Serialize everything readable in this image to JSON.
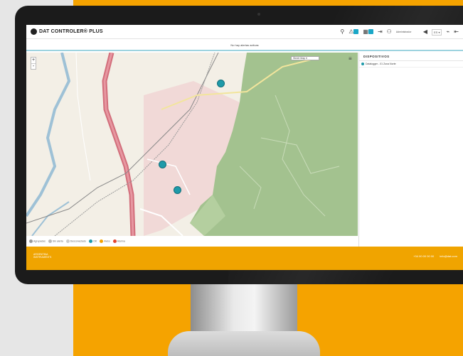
{
  "header": {
    "brand": "DAT CONTROLER® PLUS",
    "icons": [
      "pin-icon",
      "warning-icon",
      "notification-icon",
      "export-icon",
      "user-icon",
      "volume-icon",
      "language-select",
      "signal-icon",
      "logout-icon"
    ],
    "user_label": "Administrador",
    "language": "ES ▾"
  },
  "notice": "No hay alertas activas",
  "map": {
    "zoom_in": "+",
    "zoom_out": "-",
    "layer_label": "Street Map ▾",
    "legend": [
      "Agrupadas",
      "Sin alerta",
      "Desconectado",
      "OK",
      "Aviso",
      "Alarma"
    ]
  },
  "panel": {
    "title": "DISPOSITIVOS",
    "items": [
      "Datalogger - 01 Zona Norte"
    ]
  },
  "footer": {
    "company": "ARGENTINA INSTRUMENTS",
    "phone": "+34 00 00 00 00",
    "email": "info@dat.com"
  },
  "colors": {
    "accent": "#f5a300",
    "marker": "#1e9aa9",
    "forest": "#a3c28f"
  }
}
